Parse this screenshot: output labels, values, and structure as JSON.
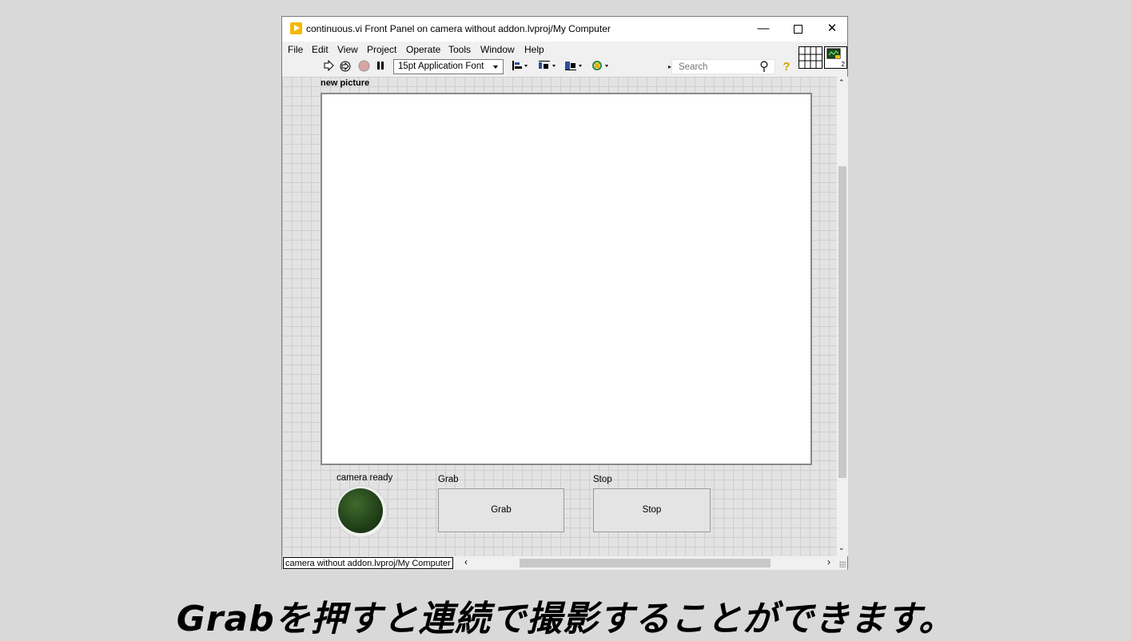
{
  "window": {
    "title": "continuous.vi Front Panel on camera without addon.lvproj/My Computer",
    "min_glyph": "—",
    "close_glyph": "✕"
  },
  "menu": [
    "File",
    "Edit",
    "View",
    "Project",
    "Operate",
    "Tools",
    "Window",
    "Help"
  ],
  "toolbar": {
    "font": "15pt Application Font",
    "search_placeholder": "Search",
    "help_glyph": "?",
    "search_glyph": "⚲"
  },
  "vi_icon_text": "2",
  "panel": {
    "picture_label": "new picture",
    "led_label": "camera ready",
    "grab_label": "Grab",
    "grab_button": "Grab",
    "stop_label": "Stop",
    "stop_button": "Stop"
  },
  "status": {
    "project": "camera without addon.lvproj/My Computer"
  },
  "caption": "Grabを押すと連続で撮影することができます。",
  "colors": {
    "led_off": "#24431a",
    "app_icon": "#f5b800"
  }
}
